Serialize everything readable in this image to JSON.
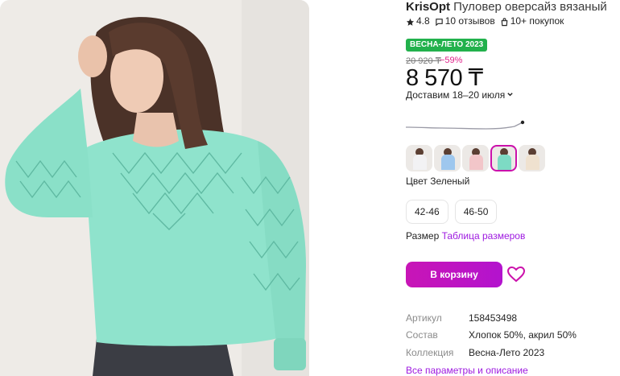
{
  "product": {
    "brand": "KrisOpt",
    "name": " Пуловер оверсайз вязаный",
    "rating": "4.8",
    "reviews": "10 отзывов",
    "purchases": "10+ покупок",
    "badge": "ВЕСНА-ЛЕТО 2023",
    "old_price": "20 920 ₸",
    "discount": "−59%",
    "price": "8 570 ₸",
    "delivery": "Доставим 18–20 июля",
    "color_label": "Цвет",
    "color_value": "Зеленый",
    "sizes": [
      "42-46",
      "46-50"
    ],
    "size_label": "Размер",
    "size_table_link": "Таблица размеров",
    "cart_button": "В корзину",
    "variants": [
      {
        "color": "#f2f2f4",
        "name": "white"
      },
      {
        "color": "#9ec7ee",
        "name": "blue"
      },
      {
        "color": "#f2c6c9",
        "name": "pink"
      },
      {
        "color": "#7ddbc4",
        "name": "mint"
      },
      {
        "color": "#efe1cf",
        "name": "beige"
      }
    ],
    "params": [
      {
        "key": "Артикул",
        "value": "158453498"
      },
      {
        "key": "Состав",
        "value": "Хлопок 50%, акрил 50%"
      },
      {
        "key": "Коллекция",
        "value": "Весна-Лето 2023"
      }
    ],
    "all_params_link": "Все параметры и описание"
  },
  "icons": {
    "rating": "star-icon",
    "reviews": "comment-icon",
    "purchases": "bag-icon",
    "favorite": "heart-icon",
    "delivery": "chevron-down-icon"
  },
  "colors": {
    "accent": "#cb11ab",
    "badge": "#22b14c",
    "discount": "#e0218a",
    "link": "#9e1ae0",
    "sweater": "#8fe3cc"
  }
}
